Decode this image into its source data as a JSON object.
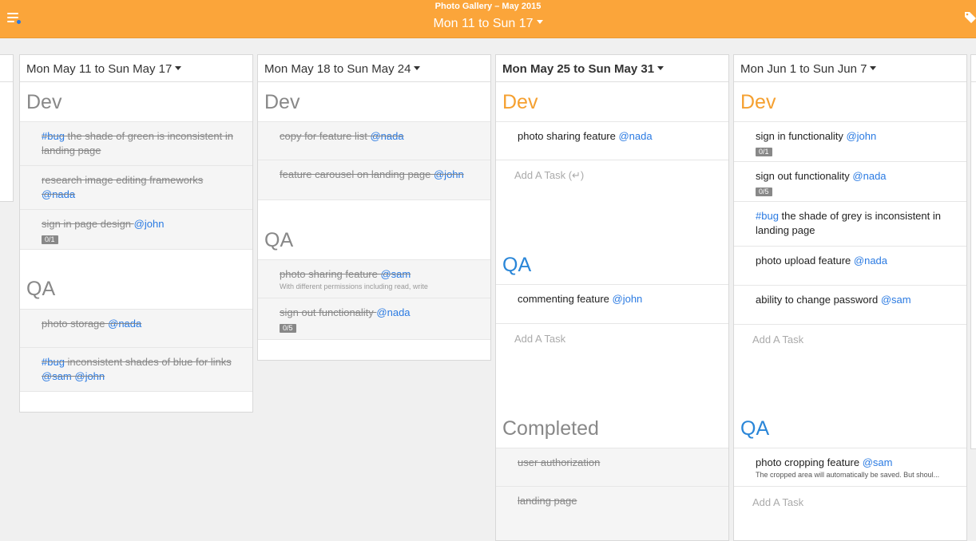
{
  "header": {
    "title": "Photo Gallery – May 2015",
    "range": "Mon 11 to Sun 17",
    "menu_icon": "menu-icon",
    "tag_icon": "tag-icon",
    "accent": "#fba53a",
    "notification_dot": "#2a7ae2"
  },
  "columns": [
    {
      "title": "Mon May 11 to Sun May 17",
      "dev": {
        "label": "Dev",
        "tasks": [
          {
            "tag": "#bug",
            "text": " the shade of green is inconsistent in landing page",
            "mention": ""
          },
          {
            "tag": "",
            "text": "research image editing frameworks ",
            "mention": "@nada"
          },
          {
            "tag": "",
            "text": "sign in page design ",
            "mention": "@john",
            "badge": "0/1"
          }
        ]
      },
      "qa": {
        "label": "QA",
        "tasks": [
          {
            "tag": "",
            "text": "photo storage ",
            "mention": "@nada"
          },
          {
            "tag": "#bug",
            "text": " inconsistent shades of blue for links ",
            "mention": "@sam @john"
          }
        ]
      }
    },
    {
      "title": "Mon May 18 to Sun May 24",
      "dev": {
        "label": "Dev",
        "tasks": [
          {
            "text": "copy for feature list ",
            "mention": "@nada"
          },
          {
            "text": "feature carousel on landing page ",
            "mention": "@john"
          }
        ]
      },
      "qa": {
        "label": "QA",
        "tasks": [
          {
            "text": "photo sharing feature ",
            "mention": "@sam",
            "note": "With different permissions including read, write"
          },
          {
            "text": "sign out functionality ",
            "mention": "@nada",
            "badge": "0/5"
          }
        ]
      }
    },
    {
      "title": "Mon May 25 to Sun May 31",
      "dev": {
        "label": "Dev",
        "tasks": [
          {
            "text": "photo sharing feature ",
            "mention": "@nada"
          }
        ],
        "add": "Add A Task (↵)"
      },
      "qa": {
        "label": "QA",
        "tasks": [
          {
            "text": "commenting feature ",
            "mention": "@john"
          }
        ],
        "add": "Add A Task"
      },
      "completed": {
        "label": "Completed",
        "tasks": [
          {
            "text": "user authorization"
          },
          {
            "text": "landing page"
          }
        ]
      }
    },
    {
      "title": "Mon Jun 1 to Sun Jun 7",
      "dev": {
        "label": "Dev",
        "tasks": [
          {
            "tag": "",
            "text": "sign in functionality ",
            "mention": "@john",
            "badge": "0/1"
          },
          {
            "tag": "",
            "text": "sign out functionality ",
            "mention": "@nada",
            "badge": "0/5"
          },
          {
            "tag": "#bug",
            "text": " the shade of grey is inconsistent in landing page",
            "mention": ""
          },
          {
            "tag": "",
            "text": "photo upload feature ",
            "mention": "@nada"
          },
          {
            "tag": "",
            "text": "ability to change password ",
            "mention": "@sam"
          }
        ],
        "add": "Add A Task"
      },
      "qa": {
        "label": "QA",
        "tasks": [
          {
            "text": "photo cropping feature ",
            "mention": "@sam",
            "note": "The cropped area will automatically be saved. But shoul..."
          }
        ],
        "add": "Add A Task"
      }
    }
  ]
}
